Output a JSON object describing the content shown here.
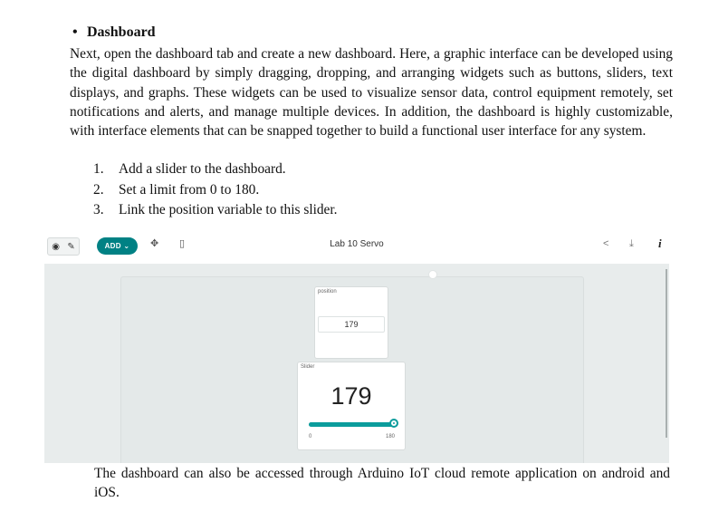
{
  "section": {
    "bullet": "•",
    "heading": "Dashboard",
    "paragraph": "Next, open the dashboard tab and create a new dashboard. Here, a graphic interface can be developed using the digital dashboard by simply dragging, dropping, and arranging widgets such as buttons, sliders, text displays, and graphs. These widgets can be used to visualize sensor data, control equipment remotely, set notifications and alerts, and manage multiple devices. In addition, the dashboard is highly customizable, with interface elements that can be snapped together to build a functional user interface for any system.",
    "steps": [
      {
        "num": "1.",
        "text": "Add a slider to the dashboard."
      },
      {
        "num": "2.",
        "text": "Set a limit from 0 to 180."
      },
      {
        "num": "3.",
        "text": "Link the position variable to this slider."
      }
    ],
    "footer": "The dashboard can also be accessed through Arduino IoT cloud remote application on android and iOS."
  },
  "screenshot": {
    "toolbar": {
      "add_label": "ADD ⌄",
      "dashboard_title": "Lab 10 Servo",
      "icons": [
        "eye-icon",
        "pencil-icon",
        "move-icon",
        "phone-icon",
        "share-icon",
        "download-icon",
        "info-icon"
      ]
    },
    "widgets": {
      "value_widget": {
        "label": "position",
        "value": "179"
      },
      "slider_widget": {
        "label": "Slider",
        "value": "179",
        "min": "0",
        "max": "180",
        "level": 0.9944
      }
    },
    "colors": {
      "accent": "#008184",
      "slider_fill": "#0b9c9c",
      "canvas": "#e8ecec"
    }
  }
}
